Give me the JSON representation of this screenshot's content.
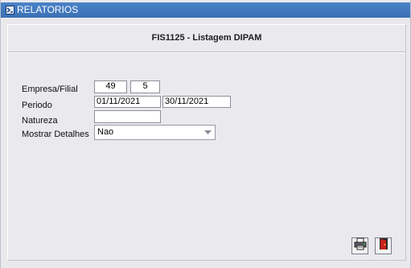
{
  "window": {
    "title": "RELATORIOS"
  },
  "report": {
    "title": "FIS1125 - Listagem DIPAM"
  },
  "form": {
    "empresa_filial": {
      "label": "Empresa/Filial",
      "empresa": "49",
      "filial": "5"
    },
    "periodo": {
      "label": "Periodo",
      "inicio": "01/11/2021",
      "fim": "30/11/2021"
    },
    "natureza": {
      "label": "Natureza",
      "value": ""
    },
    "mostrar_detalhes": {
      "label": "Mostrar Detalhes",
      "selected": "Nao"
    }
  },
  "actions": {
    "print_icon": "printer-icon",
    "exit_icon": "exit-door-icon"
  },
  "colors": {
    "titlebar": "#3f77be",
    "background": "#e9e9ee",
    "exit_red": "#c8201c"
  }
}
